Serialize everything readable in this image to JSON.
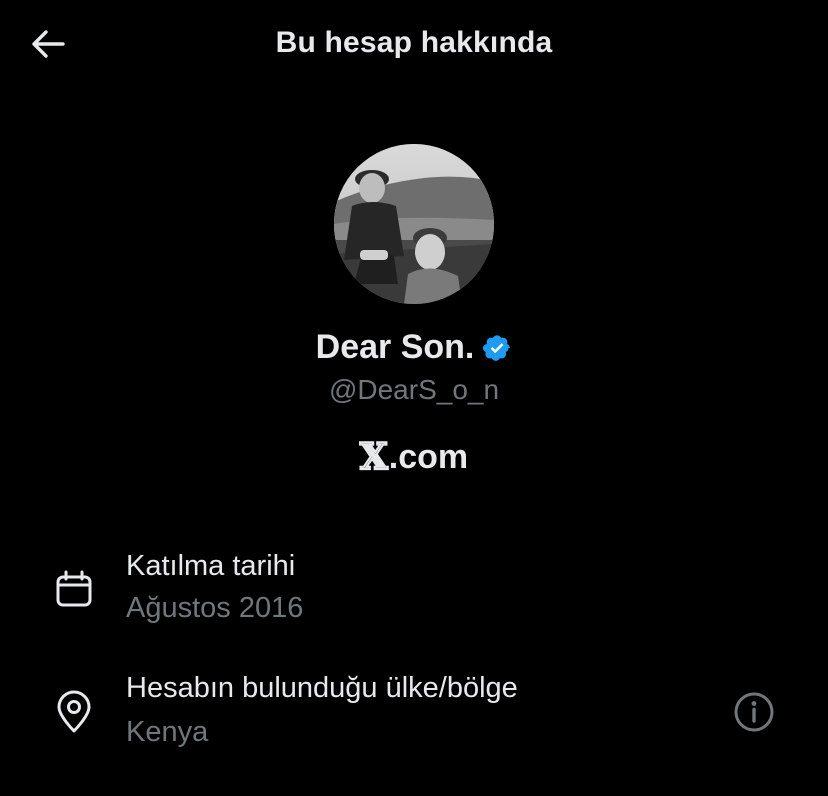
{
  "header": {
    "title": "Bu hesap hakkında",
    "back_icon": "arrow-left-icon"
  },
  "profile": {
    "display_name": "Dear Son.",
    "verified_icon": "verified-badge-icon",
    "verified_color": "#1d9bf0",
    "handle": "@DearS_o_n",
    "platform_logo": "𝕏",
    "platform_suffix": ".com"
  },
  "details": {
    "joined": {
      "icon": "calendar-icon",
      "label": "Katılma tarihi",
      "value": "Ağustos 2016"
    },
    "location": {
      "icon": "location-pin-icon",
      "label": "Hesabın bulunduğu ülke/bölge",
      "value": "Kenya",
      "action_icon": "info-icon"
    }
  },
  "colors": {
    "background": "#000000",
    "primary_text": "#e7e9ea",
    "secondary_text": "#71767b"
  }
}
